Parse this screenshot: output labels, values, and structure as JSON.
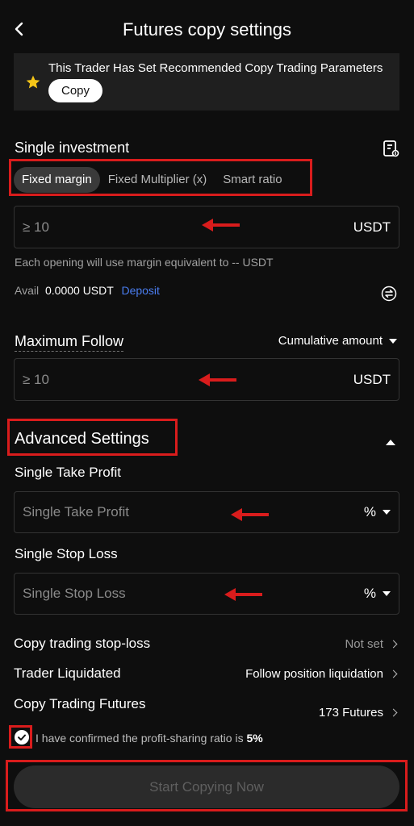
{
  "header": {
    "title": "Futures copy settings",
    "back_icon": "chevron-left-icon"
  },
  "banner": {
    "text": "This Trader Has Set Recommended Copy Trading Parameters",
    "copy_label": "Copy",
    "icon": "star-icon",
    "icon_color": "#f5c518"
  },
  "single_investment": {
    "title": "Single investment",
    "tabs": [
      {
        "label": "Fixed margin",
        "active": true
      },
      {
        "label": "Fixed Multiplier (x)",
        "active": false
      },
      {
        "label": "Smart ratio",
        "active": false
      }
    ],
    "input": {
      "placeholder": "≥ 10",
      "unit": "USDT"
    },
    "hint": "Each opening will use margin equivalent to -- USDT",
    "avail_label": "Avail",
    "avail_value": "0.0000 USDT",
    "deposit_label": "Deposit"
  },
  "maximum_follow": {
    "title": "Maximum Follow",
    "mode": "Cumulative amount",
    "input": {
      "placeholder": "≥ 10",
      "unit": "USDT"
    }
  },
  "advanced": {
    "title": "Advanced Settings",
    "take_profit": {
      "title": "Single Take Profit",
      "placeholder": "Single Take Profit",
      "unit": "%"
    },
    "stop_loss": {
      "title": "Single Stop Loss",
      "placeholder": "Single Stop Loss",
      "unit": "%"
    }
  },
  "rows": [
    {
      "label": "Copy trading stop-loss",
      "value": "Not set"
    },
    {
      "label": "Trader Liquidated",
      "value": "Follow position liquidation"
    },
    {
      "label": "Copy Trading Futures",
      "value": "173  Futures"
    }
  ],
  "confirm": {
    "text": "I have confirmed the profit-sharing ratio is ",
    "ratio": "5%"
  },
  "start_button": "Start Copying Now",
  "colors": {
    "accent_link": "#4a7df0",
    "annotation": "#d91c1c",
    "background": "#0e0e0e"
  }
}
